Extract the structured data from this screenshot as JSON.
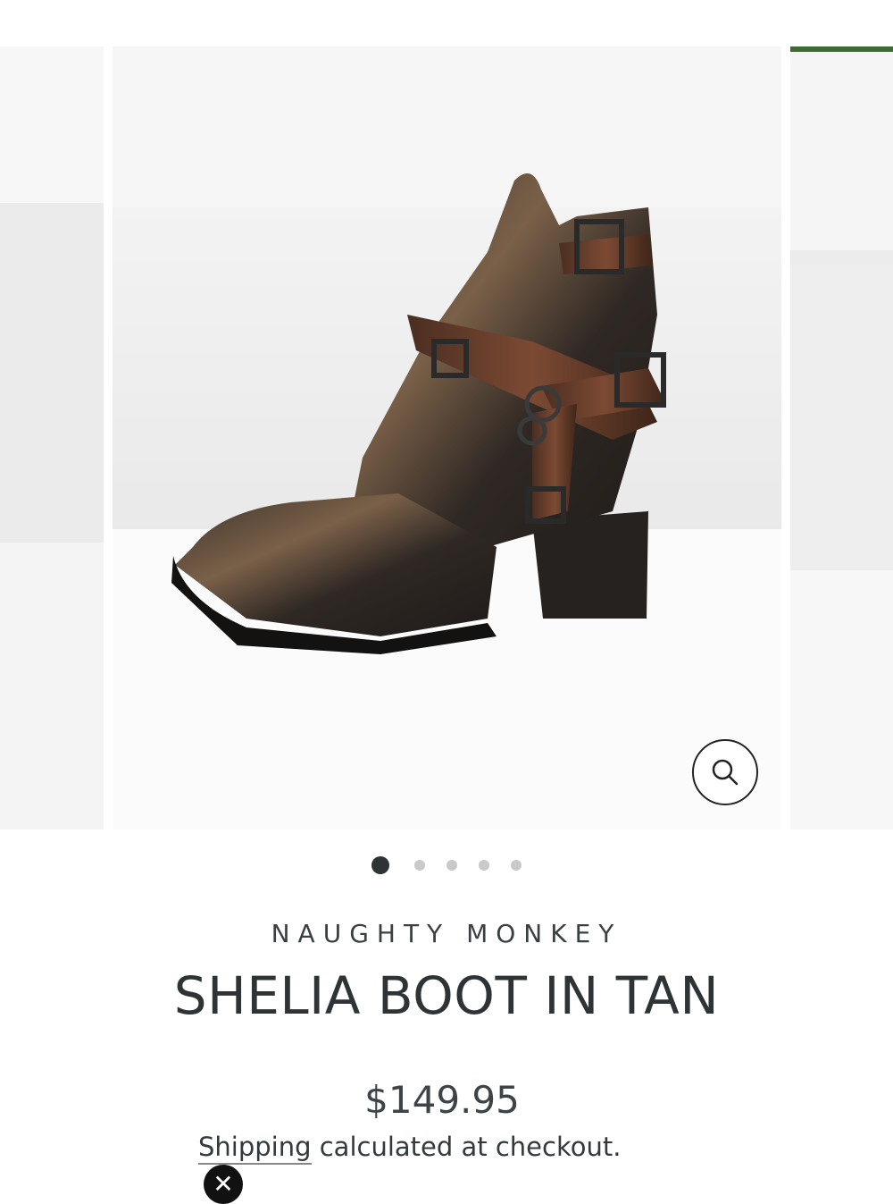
{
  "gallery": {
    "slide_count": 5,
    "active_index": 0,
    "zoom_icon": "magnifier-icon"
  },
  "product": {
    "vendor": "NAUGHTY MONKEY",
    "title": "SHELIA BOOT IN TAN",
    "price": "$149.95",
    "shipping_link": "Shipping",
    "shipping_rest": " calculated at checkout."
  },
  "overlay": {
    "close_icon": "close-icon",
    "close_glyph": "✕"
  }
}
